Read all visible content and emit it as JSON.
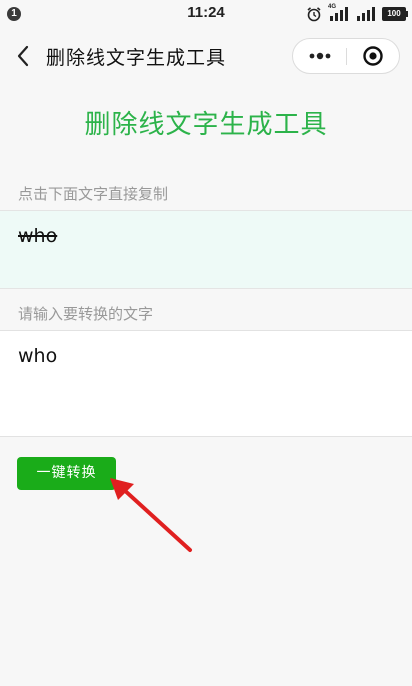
{
  "status_bar": {
    "notification_count": "1",
    "time": "11:24",
    "network_label": "4G",
    "battery_level": "100"
  },
  "nav": {
    "title": "删除线文字生成工具"
  },
  "page": {
    "heading": "删除线文字生成工具",
    "copy_label": "点击下面文字直接复制",
    "result_text": "who",
    "input_label": "请输入要转换的文字",
    "input_value": "who",
    "convert_button": "一键转换"
  },
  "colors": {
    "accent_green": "#2cb34a",
    "button_green": "#1aac19",
    "result_background": "#eefaf7",
    "arrow_red": "#e02020"
  }
}
